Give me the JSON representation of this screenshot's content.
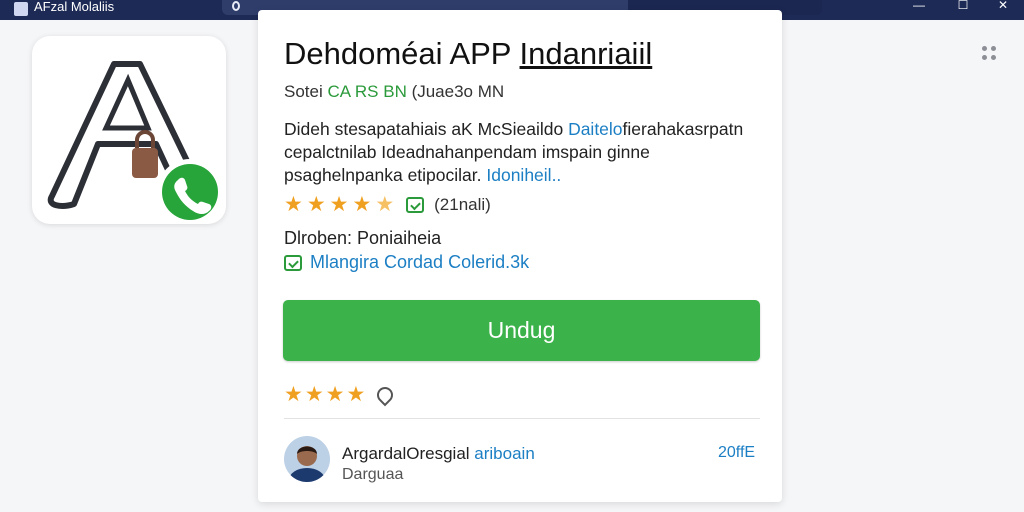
{
  "window": {
    "title": "AFzal Molaliis",
    "minimize_label": "—",
    "maximize_label": "☐",
    "close_label": "✕"
  },
  "app": {
    "title_main": "Dehdoméai APP ",
    "title_underlined": "Indanriaiil",
    "meta_prefix": "Sotei ",
    "meta_highlight": "CA RS BN",
    "meta_suffix": " (Juae3o MN",
    "description_part1": "Dideh stesapatahiais aK McSieaildo ",
    "description_link1": "Daitelo",
    "description_part2": "fierahakasrpatn cepalctnilab Ideadnahanpendam imspain ginne psaghelnpanka etipocilar. ",
    "description_link2": "Idoniheil..",
    "rating_count": "(21nali)",
    "developer_label": "Dlroben: Poniaiheia",
    "verified_text": "Mlangira Cordad Colerid.3k",
    "install_label": "Undug"
  },
  "rating": {
    "stars_filled": 4,
    "stars_half": 1,
    "star_glyph": "★"
  },
  "review": {
    "stars": 4,
    "reviewer_name": "ArgardalOresgial ",
    "reviewer_link": "ariboain",
    "reviewer_sub": "Darguaa",
    "date": "20ffE"
  },
  "colors": {
    "titlebar": "#1d2a55",
    "install_button": "#3cb34a",
    "link": "#1c7fc4",
    "star": "#f0a020",
    "verified_green": "#2b9a3a"
  },
  "icons": {
    "logo": "a-letter-logo-with-lock-and-phone-icon",
    "more": "four-dots-icon",
    "search": "search-icon"
  }
}
